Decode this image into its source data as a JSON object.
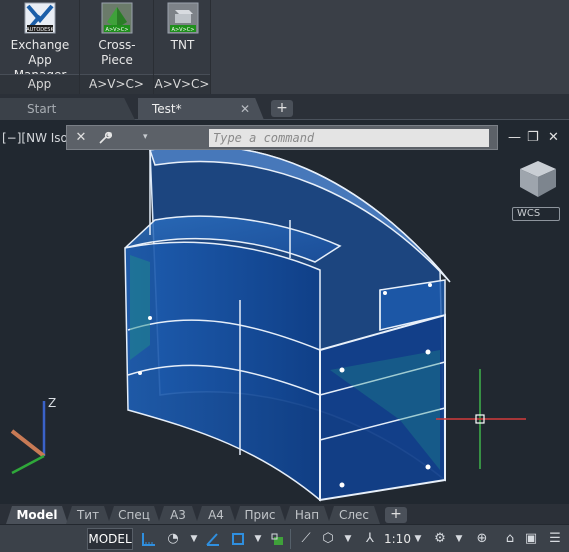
{
  "ribbon": {
    "buttons": [
      {
        "label_line1": "Exchange",
        "label_line2": "App Manager",
        "icon": "autodesk-exchange-icon"
      },
      {
        "label_line1": "Cross-Piece",
        "label_line2": "",
        "icon": "cross-piece-icon"
      },
      {
        "label_line1": "TNT",
        "label_line2": "",
        "icon": "tnt-icon"
      }
    ],
    "panels": [
      "App Manager",
      "A>V>C>",
      "A>V>C>"
    ],
    "icon_text_autodesk": "AUTODESK",
    "icon_text_avc": "A>V>C>"
  },
  "file_tabs": [
    {
      "label": "Start",
      "active": false
    },
    {
      "label": "Test*",
      "active": true,
      "close": "✕"
    }
  ],
  "file_tab_add": "+",
  "viewport": {
    "label": "[−][NW Isometric][Realistic]",
    "command_placeholder": "Type a command",
    "cmd_close": "✕",
    "window_controls": {
      "minimize": "—",
      "restore": "❐",
      "close": "✕"
    },
    "wcs": "WCS",
    "axis_z": "Z"
  },
  "layout_tabs": [
    "Model",
    "Тит",
    "Спец",
    "А3",
    "А4",
    "Прис",
    "Нап",
    "Слес"
  ],
  "layout_tab_add": "+",
  "statusbar": {
    "model": "MODEL",
    "scale": "1:10"
  },
  "colors": {
    "accent_blue": "#1e72c8",
    "solid_blue": "#0d4fa6",
    "background": "#212830"
  }
}
